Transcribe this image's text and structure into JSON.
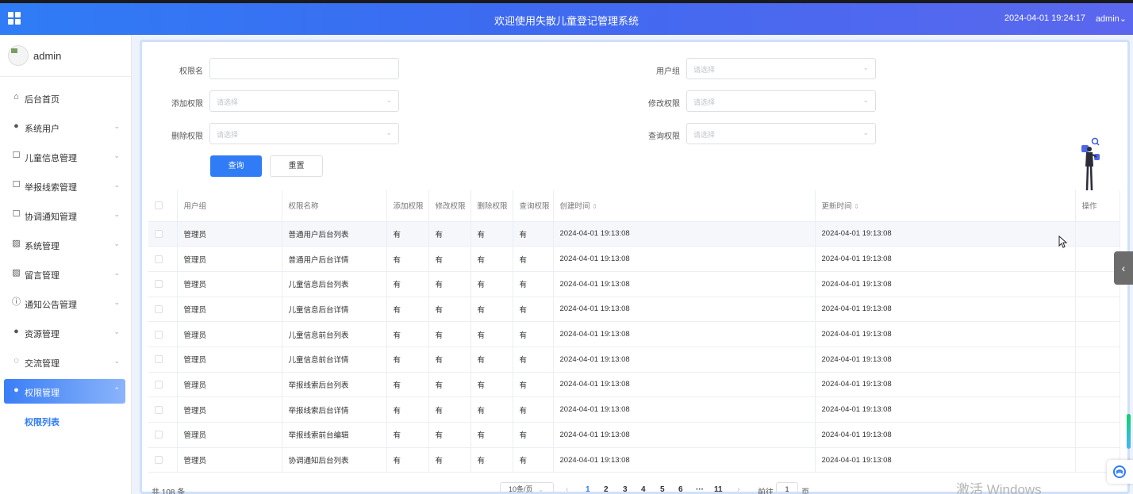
{
  "header": {
    "title": "欢迎使用失散儿童登记管理系统",
    "datetime": "2024-04-01 19:24:17",
    "user": "admin",
    "user_caret": "⌄",
    "menu_icon": "grid-icon",
    "gradient": [
      "#2f7cf6",
      "#5b67ee"
    ]
  },
  "sidebar": {
    "username": "admin",
    "items": [
      {
        "label": "后台首页",
        "icon": "home-icon"
      },
      {
        "label": "系统用户",
        "icon": "user-icon"
      },
      {
        "label": "儿童信息管理",
        "icon": "document-icon"
      },
      {
        "label": "举报线索管理",
        "icon": "document-icon"
      },
      {
        "label": "协调通知管理",
        "icon": "document-icon"
      },
      {
        "label": "系统管理",
        "icon": "image-icon"
      },
      {
        "label": "留言管理",
        "icon": "image-icon"
      },
      {
        "label": "通知公告管理",
        "icon": "info-icon"
      },
      {
        "label": "资源管理",
        "icon": "location-icon"
      },
      {
        "label": "交流管理",
        "icon": "chat-icon"
      },
      {
        "label": "权限管理",
        "icon": "user-icon",
        "active": true
      },
      {
        "label": "权限列表",
        "sub": true
      }
    ]
  },
  "filters": {
    "perm_name_label": "权限名",
    "perm_name_value": "",
    "user_group_label": "用户组",
    "user_group_placeholder": "请选择",
    "add_label": "添加权限",
    "add_placeholder": "请选择",
    "modify_label": "修改权限",
    "modify_placeholder": "请选择",
    "delete_label": "删除权限",
    "delete_placeholder": "请选择",
    "query_label": "查询权限",
    "query_placeholder": "请选择",
    "search_button": "查询",
    "reset_button": "重置"
  },
  "table": {
    "headers": [
      "用户组",
      "权限名称",
      "添加权限",
      "修改权限",
      "删除权限",
      "查询权限",
      "创建时间",
      "更新时间",
      "操作"
    ],
    "sort_glyph": "⇕",
    "rows": [
      [
        "管理员",
        "普通用户后台列表",
        "有",
        "有",
        "有",
        "有",
        "2024-04-01 19:13:08",
        "2024-04-01 19:13:08"
      ],
      [
        "管理员",
        "普通用户后台详情",
        "有",
        "有",
        "有",
        "有",
        "2024-04-01 19:13:08",
        "2024-04-01 19:13:08"
      ],
      [
        "管理员",
        "儿童信息后台列表",
        "有",
        "有",
        "有",
        "有",
        "2024-04-01 19:13:08",
        "2024-04-01 19:13:08"
      ],
      [
        "管理员",
        "儿童信息后台详情",
        "有",
        "有",
        "有",
        "有",
        "2024-04-01 19:13:08",
        "2024-04-01 19:13:08"
      ],
      [
        "管理员",
        "儿童信息前台列表",
        "有",
        "有",
        "有",
        "有",
        "2024-04-01 19:13:08",
        "2024-04-01 19:13:08"
      ],
      [
        "管理员",
        "儿童信息前台详情",
        "有",
        "有",
        "有",
        "有",
        "2024-04-01 19:13:08",
        "2024-04-01 19:13:08"
      ],
      [
        "管理员",
        "举报线索后台列表",
        "有",
        "有",
        "有",
        "有",
        "2024-04-01 19:13:08",
        "2024-04-01 19:13:08"
      ],
      [
        "管理员",
        "举报线索后台详情",
        "有",
        "有",
        "有",
        "有",
        "2024-04-01 19:13:08",
        "2024-04-01 19:13:08"
      ],
      [
        "管理员",
        "举报线索前台编辑",
        "有",
        "有",
        "有",
        "有",
        "2024-04-01 19:13:08",
        "2024-04-01 19:13:08"
      ],
      [
        "管理员",
        "协调通知后台列表",
        "有",
        "有",
        "有",
        "有",
        "2024-04-01 19:13:08",
        "2024-04-01 19:13:08"
      ]
    ]
  },
  "pagination": {
    "total": "共 108 条",
    "page_size": "10条/页",
    "prev": "‹",
    "next": "›",
    "pages": [
      "1",
      "2",
      "3",
      "4",
      "5",
      "6",
      "···",
      "11"
    ],
    "current": "1",
    "goto_label": "前往",
    "goto_value": "1",
    "goto_unit": "页"
  },
  "watermark": "激活 Windows",
  "side_tab_glyph": "‹"
}
